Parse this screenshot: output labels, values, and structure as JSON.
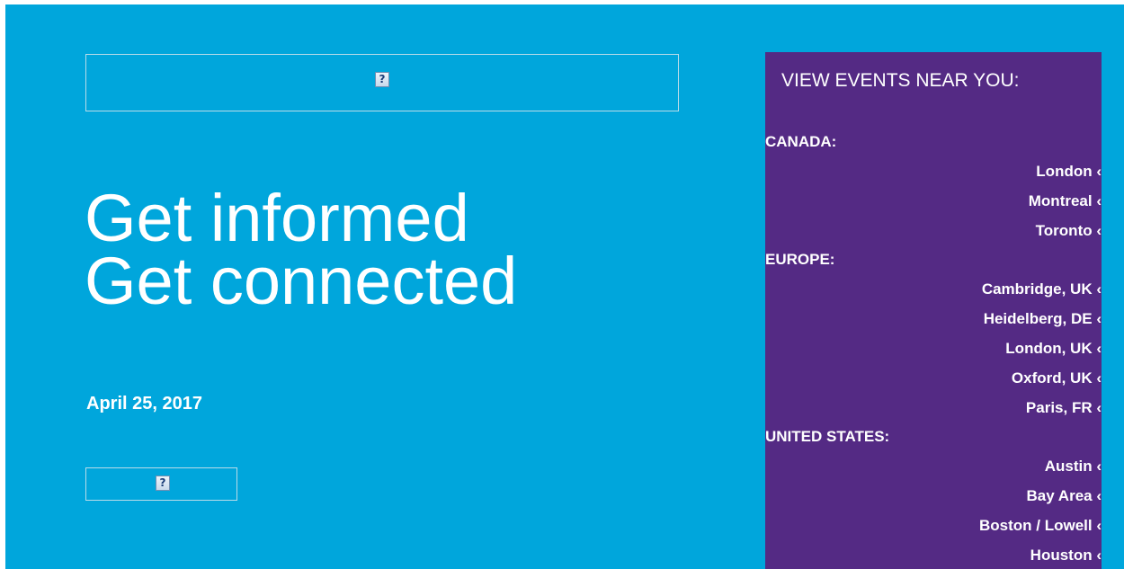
{
  "hero": {
    "line1": "Get informed",
    "line2": "Get connected",
    "date": "April 25, 2017"
  },
  "images": {
    "top_icon": "?",
    "bottom_icon": "?"
  },
  "sidebar": {
    "title": "VIEW EVENTS NEAR YOU:",
    "regions": [
      {
        "name": "CANADA:",
        "cities": [
          "London ‹",
          "Montreal ‹",
          "Toronto ‹"
        ]
      },
      {
        "name": "EUROPE:",
        "cities": [
          "Cambridge, UK ‹",
          "Heidelberg, DE ‹",
          "London, UK ‹",
          "Oxford, UK ‹",
          "Paris, FR ‹"
        ]
      },
      {
        "name": "UNITED STATES:",
        "cities": [
          "Austin ‹",
          "Bay Area ‹",
          "Boston / Lowell ‹",
          "Houston ‹"
        ]
      }
    ]
  },
  "colors": {
    "page_background": "#00a6dc",
    "sidebar_background": "#542a84",
    "text": "#ffffff"
  }
}
